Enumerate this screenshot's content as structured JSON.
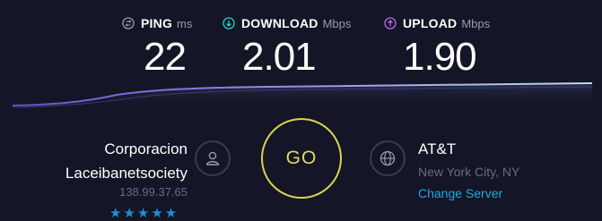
{
  "metrics": {
    "ping": {
      "label": "PING",
      "unit": "ms",
      "value": "22",
      "icon": "ping-icon",
      "color": "#9b9aab"
    },
    "download": {
      "label": "DOWNLOAD",
      "unit": "Mbps",
      "value": "2.01",
      "icon": "download-arrow-icon",
      "color": "#1fd2cf"
    },
    "upload": {
      "label": "UPLOAD",
      "unit": "Mbps",
      "value": "1.90",
      "icon": "upload-arrow-icon",
      "color": "#b46ff0"
    }
  },
  "isp": {
    "name_line1": "Corporacion",
    "name_line2": "Laceibanetsociety",
    "ip": "138.99.37.65",
    "rating_stars": 5,
    "stars_text": "★★★★★",
    "icon": "user-icon"
  },
  "go_button": {
    "label": "GO",
    "color": "#d8d452"
  },
  "server": {
    "name": "AT&T",
    "location": "New York City, NY",
    "change_label": "Change Server",
    "icon": "globe-icon"
  },
  "colors": {
    "background": "#141526",
    "graph_line_start": "#5b53c9",
    "graph_line_end": "#a9d4f2",
    "link": "#1eabe0",
    "muted": "#6a6b82"
  }
}
